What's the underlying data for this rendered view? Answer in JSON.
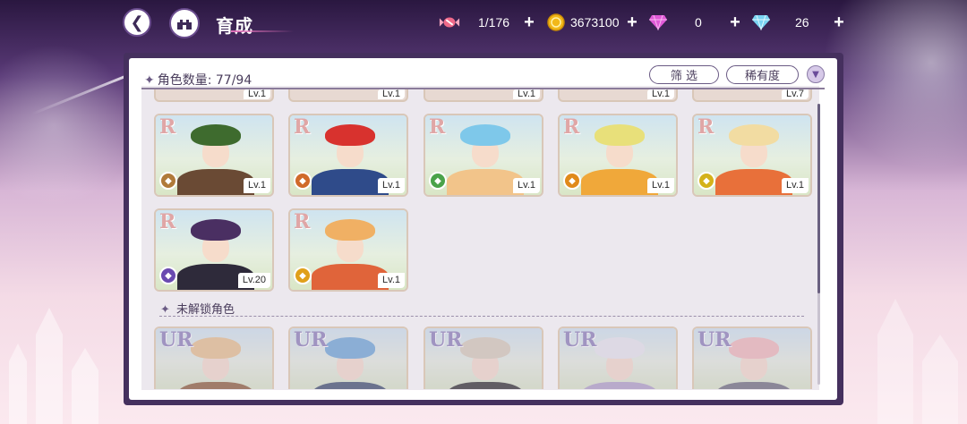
{
  "header": {
    "title": "育成",
    "resources": [
      {
        "icon": "candy-icon",
        "value": "1/176"
      },
      {
        "icon": "gold-coin-icon",
        "value": "3673100"
      },
      {
        "icon": "pink-gem-icon",
        "value": "0"
      },
      {
        "icon": "blue-diamond-icon",
        "value": "26"
      }
    ]
  },
  "panel": {
    "count_label": "角色数量: 77/94",
    "filter_label": "筛 选",
    "rarity_label": "稀有度",
    "locked_section_label": "未解锁角色"
  },
  "partial_row": {
    "levels": [
      "Lv.1",
      "Lv.1",
      "Lv.1",
      "Lv.1",
      "Lv.7"
    ]
  },
  "unlocked": [
    {
      "rarity": "R",
      "level": "Lv.1",
      "hair": "#3e6b2e",
      "outfit": "#6a4a34",
      "attr_color": "#b07a3a",
      "attr_icon": "shield-icon"
    },
    {
      "rarity": "R",
      "level": "Lv.1",
      "hair": "#d8322e",
      "outfit": "#2f4b8a",
      "attr_color": "#d06a2a",
      "attr_icon": "fist-icon"
    },
    {
      "rarity": "R",
      "level": "Lv.1",
      "hair": "#7ec8ea",
      "outfit": "#f2c48a",
      "attr_color": "#4aa34a",
      "attr_icon": "leaf-icon"
    },
    {
      "rarity": "R",
      "level": "Lv.1",
      "hair": "#e8e07a",
      "outfit": "#f0a83a",
      "attr_color": "#e08a1a",
      "attr_icon": "wand-icon"
    },
    {
      "rarity": "R",
      "level": "Lv.1",
      "hair": "#f2dca2",
      "outfit": "#e8703a",
      "attr_color": "#d4b21a",
      "attr_icon": "scroll-icon"
    },
    {
      "rarity": "R",
      "level": "Lv.20",
      "hair": "#4a2f62",
      "outfit": "#2e2a3a",
      "attr_color": "#6a4ab0",
      "attr_icon": "book-icon"
    },
    {
      "rarity": "R",
      "level": "Lv.1",
      "hair": "#f0b064",
      "outfit": "#e0643a",
      "attr_color": "#e0a01a",
      "attr_icon": "card-icon"
    }
  ],
  "locked": [
    {
      "rarity": "UR",
      "hair": "#e8c08a",
      "outfit": "#8a5a34"
    },
    {
      "rarity": "UR",
      "hair": "#6aa6d8",
      "outfit": "#3a4a6a"
    },
    {
      "rarity": "UR",
      "hair": "#d8ccb8",
      "outfit": "#2a2a2a"
    },
    {
      "rarity": "UR",
      "hair": "#e8e8ee",
      "outfit": "#b0a0c8"
    },
    {
      "rarity": "UR",
      "hair": "#f2b8b8",
      "outfit": "#6a6a7a"
    }
  ]
}
